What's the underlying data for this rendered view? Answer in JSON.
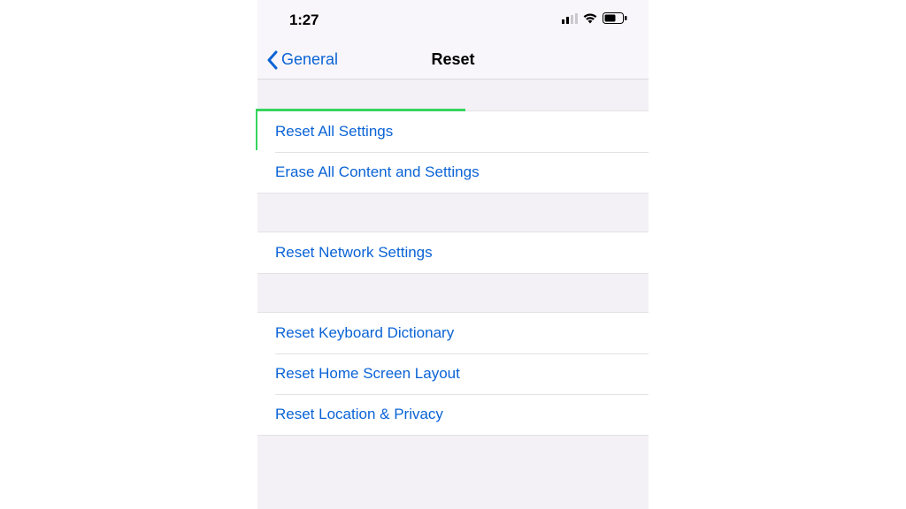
{
  "status": {
    "time": "1:27"
  },
  "nav": {
    "back_label": "General",
    "title": "Reset"
  },
  "groups": [
    {
      "items": [
        {
          "key": "reset-all-settings",
          "label": "Reset All Settings",
          "highlighted": true
        },
        {
          "key": "erase-all",
          "label": "Erase All Content and Settings"
        }
      ]
    },
    {
      "items": [
        {
          "key": "reset-network",
          "label": "Reset Network Settings"
        }
      ]
    },
    {
      "items": [
        {
          "key": "reset-keyboard",
          "label": "Reset Keyboard Dictionary"
        },
        {
          "key": "reset-home",
          "label": "Reset Home Screen Layout"
        },
        {
          "key": "reset-location-privacy",
          "label": "Reset Location & Privacy"
        }
      ]
    }
  ],
  "colors": {
    "link": "#0a63d6",
    "highlight": "#36d45f",
    "group_bg": "#f3f1f5"
  }
}
